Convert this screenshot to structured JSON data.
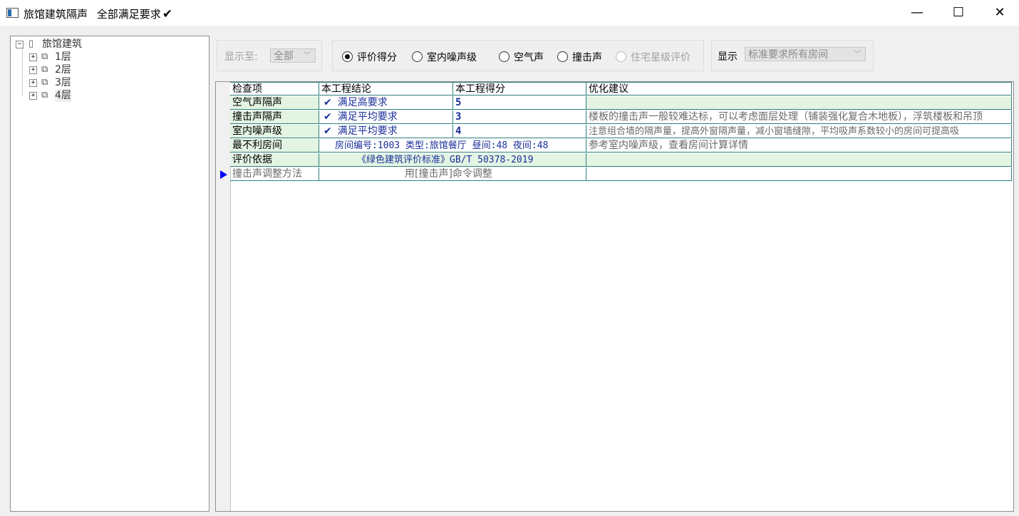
{
  "window": {
    "title": "旅馆建筑隔声",
    "status": "全部满足要求",
    "status_icon": "checkmark-icon",
    "buttons": {
      "minimize": "—",
      "maximize": "☐",
      "close": "✕"
    }
  },
  "tree": {
    "root": {
      "label": "旅馆建筑",
      "expander": "−"
    },
    "items": [
      {
        "label": "1层",
        "expander": "+"
      },
      {
        "label": "2层",
        "expander": "+"
      },
      {
        "label": "3层",
        "expander": "+"
      },
      {
        "label": "4层",
        "expander": "+"
      }
    ]
  },
  "toolbar": {
    "display_to_label": "显示至:",
    "display_to_value": "全部",
    "radios": [
      {
        "label": "评价得分",
        "checked": true,
        "disabled": false
      },
      {
        "label": "室内噪声级",
        "checked": false,
        "disabled": false
      },
      {
        "label": "空气声",
        "checked": false,
        "disabled": false
      },
      {
        "label": "撞击声",
        "checked": false,
        "disabled": false
      },
      {
        "label": "住宅星级评价",
        "checked": false,
        "disabled": true
      }
    ],
    "show_label": "显示",
    "show_value": "标准要求所有房间"
  },
  "grid": {
    "headers": [
      "检查项",
      "本工程结论",
      "本工程得分",
      "优化建议"
    ],
    "rows": [
      {
        "item": "空气声隔声",
        "conclusion": "满足高要求",
        "check": "✔",
        "score": "5",
        "advice": ""
      },
      {
        "item": "撞击声隔声",
        "conclusion": "满足平均要求",
        "check": "✔",
        "score": "3",
        "advice": "楼板的撞击声一般较难达标，可以考虑面层处理（铺装强化复合木地板），浮筑楼板和吊顶"
      },
      {
        "item": "室内噪声级",
        "conclusion": "满足平均要求",
        "check": "✔",
        "score": "4",
        "advice": "注意组合墙的隔声量，提高外窗隔声量，减小窗墙缝隙，平均吸声系数较小的房间可提高吸"
      },
      {
        "item": "最不利房间",
        "conclusion": "房间编号:1003 类型:旅馆餐厅 昼间:48 夜间:48",
        "check": "",
        "score": "",
        "advice": "参考室内噪声级，查看房间计算详情"
      },
      {
        "item": "评价依据",
        "conclusion": "《绿色建筑评价标准》GB/T 50378-2019",
        "check": "",
        "score": "",
        "advice": ""
      },
      {
        "item": "撞击声调整方法",
        "conclusion": "用[撞击声]命令调整",
        "check": "",
        "score": "",
        "advice": ""
      }
    ],
    "current_row_indicator": "▶"
  },
  "colors": {
    "row_highlight": "#e3f4e3",
    "grid_line": "#2f7f7f",
    "link_text": "#1a2f9a",
    "pointer": "#0000ff"
  }
}
